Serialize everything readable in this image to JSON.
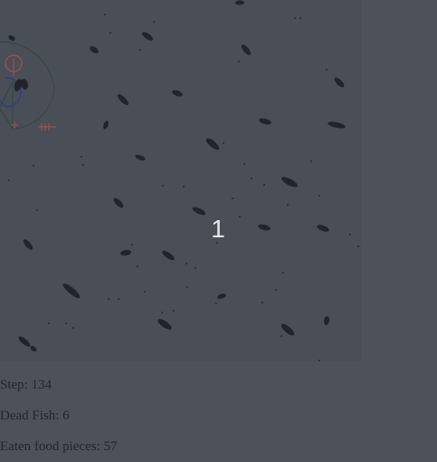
{
  "simulation": {
    "center_label": "1"
  },
  "stats": {
    "step_label": "Step: 134",
    "dead_fish_label": "Dead Fish: 6",
    "eaten_food_label": "Eaten food pieces: 57"
  },
  "colors": {
    "background": "#4d515a",
    "canvas": "#4a4e56",
    "fish": "#23272d",
    "food": "#2f333a",
    "sensor_ring": "#2f4a3c",
    "sensor_red": "#b5504e",
    "sensor_blue": "#2d3a9a",
    "center_label": "#e6e6e6"
  }
}
